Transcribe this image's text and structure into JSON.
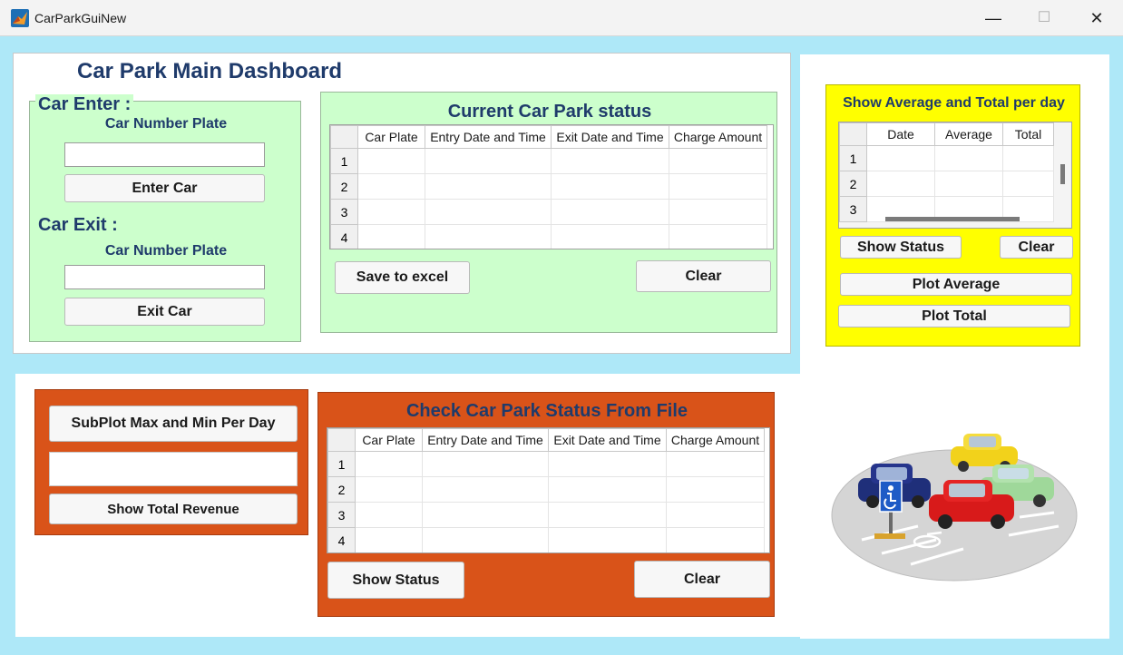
{
  "window": {
    "title": "CarParkGuiNew",
    "minimize_glyph": "—",
    "maximize_glyph": "☐",
    "close_glyph": "✕"
  },
  "dashboard": {
    "title": "Car Park Main Dashboard",
    "car_enter": {
      "heading": "Car Enter :",
      "plate_label": "Car Number Plate",
      "plate_value": "",
      "button": "Enter Car"
    },
    "car_exit": {
      "heading": "Car Exit :",
      "plate_label": "Car Number Plate",
      "plate_value": "",
      "button": "Exit Car"
    },
    "status": {
      "title": "Current Car Park status",
      "columns": [
        "Car Plate",
        "Entry Date and Time",
        "Exit Date and Time",
        "Charge Amount"
      ],
      "rows": [
        "1",
        "2",
        "3",
        "4"
      ],
      "save_button": "Save to excel",
      "clear_button": "Clear"
    }
  },
  "stats": {
    "title": "Show Average and Total per day",
    "columns": [
      "Date",
      "Average",
      "Total"
    ],
    "rows": [
      "1",
      "2",
      "3"
    ],
    "show_status_button": "Show Status",
    "clear_button": "Clear",
    "plot_average_button": "Plot Average",
    "plot_total_button": "Plot Total"
  },
  "revenue": {
    "subplot_button": "SubPlot Max and Min Per Day",
    "revenue_value": "",
    "show_total_button": "Show Total Revenue"
  },
  "file_status": {
    "title": "Check Car Park Status From File",
    "columns": [
      "Car Plate",
      "Entry Date and Time",
      "Exit Date and Time",
      "Charge Amount"
    ],
    "rows": [
      "1",
      "2",
      "3",
      "4"
    ],
    "show_status_button": "Show Status",
    "clear_button": "Clear"
  },
  "colors": {
    "background": "#aee8f8",
    "green_panel": "#ccffcc",
    "yellow_panel": "#ffff00",
    "orange_panel": "#d95319",
    "title_blue": "#1f3b6b"
  },
  "image": {
    "name": "car-park-illustration"
  }
}
